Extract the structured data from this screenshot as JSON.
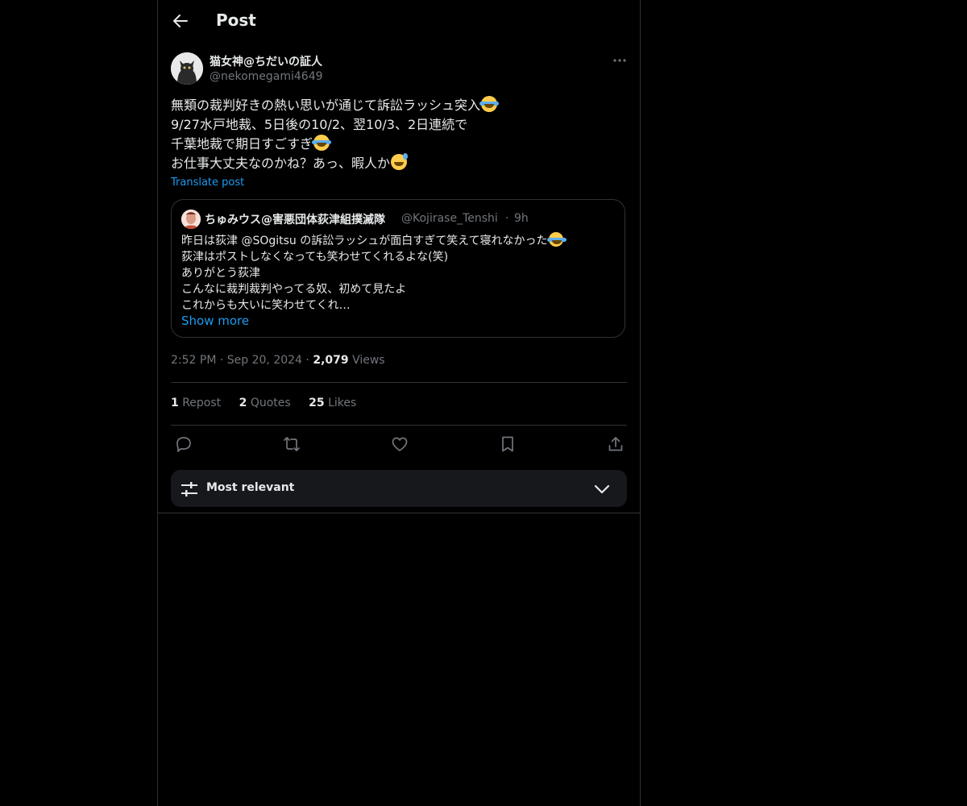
{
  "header": {
    "title": "Post"
  },
  "author": {
    "name": "猫女神@ちだいの証人",
    "handle": "@nekomegami4649"
  },
  "post": {
    "lines": [
      "無類の裁判好きの熱い思いが通じて訴訟ラッシュ突入",
      "9/27水戸地裁、5日後の10/2、翌10/3、2日連続で",
      "千葉地裁で期日すごすぎ",
      "お仕事大丈夫なのかね？あっ、暇人か"
    ],
    "translate_label": "Translate post"
  },
  "quote": {
    "name": "ちゅみウス@害悪団体荻津組撲滅隊",
    "handle": "@Kojirase_Tenshi",
    "separator": "·",
    "time": "9h",
    "lines": [
      "昨日は荻津 @SOgitsu の訴訟ラッシュが面白すぎて笑えて寝れなかった",
      "荻津はポストしなくなっても笑わせてくれるよな(笑)",
      "ありがとう荻津",
      "こんなに裁判裁判やってる奴、初めて見たよ",
      "これからも大いに笑わせてくれ…"
    ],
    "show_more": "Show more"
  },
  "meta": {
    "time": "2:52 PM",
    "sep": "·",
    "date": "Sep 20, 2024",
    "views_count": "2,079",
    "views_label": "Views"
  },
  "stats": {
    "repost_count": "1",
    "repost_label": "Repost",
    "quotes_count": "2",
    "quotes_label": "Quotes",
    "likes_count": "25",
    "likes_label": "Likes"
  },
  "actions": [
    "reply-icon",
    "repost-icon",
    "like-icon",
    "bookmark-icon",
    "share-icon"
  ],
  "filter": {
    "label": "Most relevant"
  },
  "colors": {
    "background": "#000000",
    "text": "#e7e9ea",
    "muted": "#71767b",
    "accent": "#1d9bf0",
    "border": "#2f3336"
  }
}
